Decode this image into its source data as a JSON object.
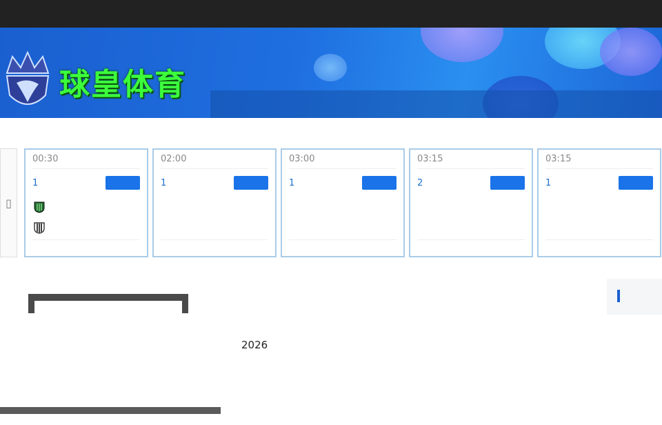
{
  "top_notice": "",
  "brand": {
    "logo_text": "球皇体育"
  },
  "nav": {
    "items": [
      "",
      "",
      "",
      "",
      ""
    ]
  },
  "matches": [
    {
      "time": "00:30",
      "league": "1",
      "home": "",
      "away": "",
      "home_crest": "shield-green-icon",
      "away_crest": "shield-bw-icon",
      "more": ""
    },
    {
      "time": "02:00",
      "league": "1",
      "home": "",
      "away": "",
      "home_crest": "",
      "away_crest": "",
      "more": ""
    },
    {
      "time": "03:00",
      "league": "1",
      "home": "",
      "away": "",
      "home_crest": "",
      "away_crest": "",
      "more": ""
    },
    {
      "time": "03:15",
      "league": "2",
      "home": "",
      "away": "",
      "home_crest": "",
      "away_crest": "",
      "more": ""
    },
    {
      "time": "03:15",
      "league": "1",
      "home": "",
      "away": "",
      "home_crest": "",
      "away_crest": "",
      "more": ""
    }
  ],
  "article": {
    "title": "",
    "lines": [
      "",
      "2026",
      "",
      "",
      ""
    ]
  },
  "sidebar": {
    "title": ""
  },
  "colors": {
    "accent": "#1a73e8",
    "logo_green": "#3cff3c",
    "topbar": "#222222"
  }
}
